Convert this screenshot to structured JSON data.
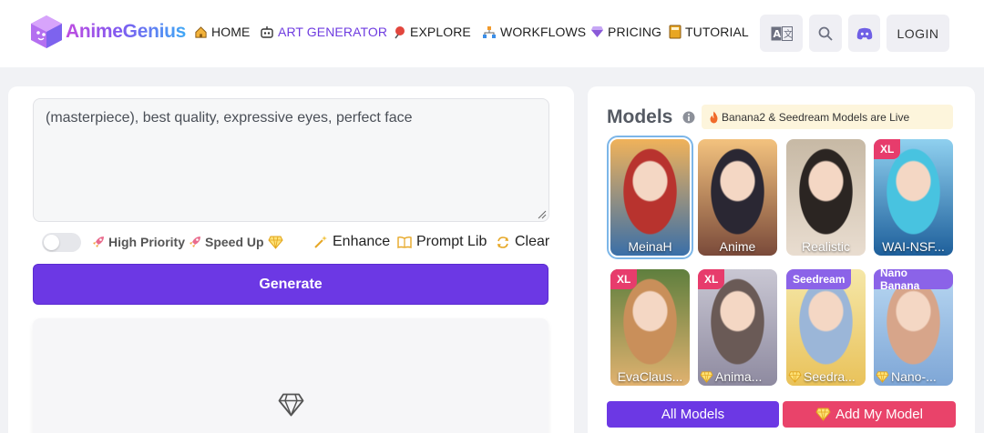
{
  "brand": {
    "name": "AnimeGenius"
  },
  "nav": [
    {
      "label": "HOME",
      "icon": "home-icon"
    },
    {
      "label": "ART GENERATOR",
      "icon": "robot-icon",
      "active": true
    },
    {
      "label": "EXPLORE",
      "icon": "pin-icon"
    },
    {
      "label": "WORKFLOWS",
      "icon": "workflow-icon"
    },
    {
      "label": "PRICING",
      "icon": "gem-icon"
    },
    {
      "label": "TUTORIAL",
      "icon": "book-icon"
    }
  ],
  "header_actions": {
    "translate_icon": "translate-icon",
    "search_icon": "search-icon",
    "discord_icon": "discord-icon",
    "login_label": "LOGIN"
  },
  "prompt": {
    "value": "(masterpiece), best quality, expressive eyes, perfect face"
  },
  "options": {
    "high_priority_label": "High Priority",
    "speed_up_label": "Speed Up",
    "enhance_label": "Enhance",
    "prompt_lib_label": "Prompt Lib",
    "clear_label": "Clear"
  },
  "generate_label": "Generate",
  "models": {
    "title": "Models",
    "live_banner": "Banana2 & Seedream Models are Live",
    "cards": [
      {
        "name": "MeinaH",
        "badge": "",
        "premium": false,
        "selected": true,
        "colors": [
          "#f0b25a",
          "#3a6fa8",
          "#b8332e"
        ]
      },
      {
        "name": "Anime",
        "badge": "",
        "premium": false,
        "selected": false,
        "colors": [
          "#f3c27e",
          "#7a4a3a",
          "#2a2733"
        ]
      },
      {
        "name": "Realistic",
        "badge": "",
        "premium": false,
        "selected": false,
        "colors": [
          "#c7b9a5",
          "#e9ddd0",
          "#2b2522"
        ]
      },
      {
        "name": "WAI-NSF...",
        "badge": "XL",
        "premium": false,
        "selected": false,
        "colors": [
          "#8fd0ef",
          "#1e5f9b",
          "#48c3e0"
        ]
      },
      {
        "name": "EvaClaus...",
        "badge": "XL",
        "premium": false,
        "selected": false,
        "colors": [
          "#5f7f3e",
          "#e1b270",
          "#c98f5a"
        ]
      },
      {
        "name": "Anima...",
        "badge": "XL",
        "premium": true,
        "selected": false,
        "colors": [
          "#c9c7d3",
          "#8e8aa0",
          "#6a5a56"
        ]
      },
      {
        "name": "Seedra...",
        "badge": "Seedream",
        "premium": true,
        "selected": false,
        "colors": [
          "#f5e7a8",
          "#e9c25a",
          "#9bb6d8"
        ]
      },
      {
        "name": "Nano-...",
        "badge": "Nano Banana",
        "premium": true,
        "selected": false,
        "colors": [
          "#b9d8f2",
          "#7ea6d6",
          "#d7a58a"
        ]
      }
    ],
    "all_models_label": "All Models",
    "add_model_label": "Add My Model"
  },
  "colors": {
    "accent": "#6c38e4",
    "pink": "#e9436a",
    "banner": "#fdf5dc"
  }
}
